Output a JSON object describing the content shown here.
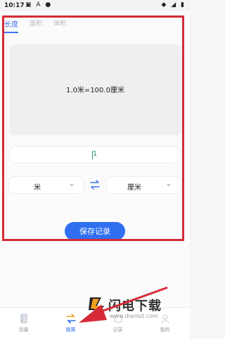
{
  "status_bar": {
    "time": "10:17",
    "icons_left": "▣ A ●",
    "icons_right": "◆ ◢ ▮"
  },
  "tabs": [
    {
      "label": "长度",
      "active": true
    },
    {
      "label": "面积",
      "active": false
    },
    {
      "label": "体积",
      "active": false
    }
  ],
  "result": {
    "text": "1.0米=100.0厘米"
  },
  "input": {
    "value": "1"
  },
  "unit_from": {
    "selected": "米"
  },
  "unit_to": {
    "selected": "厘米"
  },
  "save_button": {
    "label": "保存记录"
  },
  "bottom_nav": [
    {
      "label": "测量",
      "icon": "ruler-icon",
      "active": false
    },
    {
      "label": "换算",
      "icon": "swap-icon",
      "active": true
    },
    {
      "label": "记录",
      "icon": "list-icon",
      "active": false
    },
    {
      "label": "我的",
      "icon": "user-icon",
      "active": false
    }
  ],
  "watermark": {
    "title": "闪电下载",
    "url": "www.dianlut.com"
  },
  "colors": {
    "accent": "#2f6ff0",
    "highlight_frame": "#d62b37",
    "input_text": "#2d8c6b"
  }
}
